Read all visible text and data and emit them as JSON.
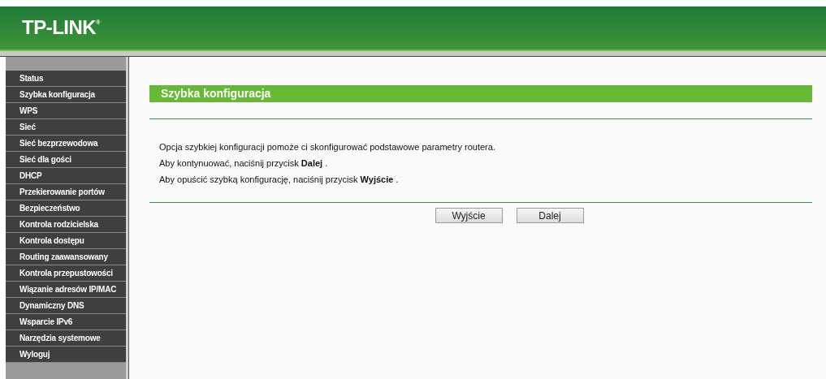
{
  "header": {
    "logo": "TP-LINK",
    "logo_mark": "®"
  },
  "sidebar": {
    "items": [
      {
        "label": "Status"
      },
      {
        "label": "Szybka konfiguracja"
      },
      {
        "label": "WPS"
      },
      {
        "label": "Sieć"
      },
      {
        "label": "Sieć bezprzewodowa"
      },
      {
        "label": "Sieć dla gości"
      },
      {
        "label": "DHCP"
      },
      {
        "label": "Przekierowanie portów"
      },
      {
        "label": "Bezpieczeństwo"
      },
      {
        "label": "Kontrola rodzicielska"
      },
      {
        "label": "Kontrola dostępu"
      },
      {
        "label": "Routing zaawansowany"
      },
      {
        "label": "Kontrola przepustowości"
      },
      {
        "label": "Wiązanie adresów IP/MAC"
      },
      {
        "label": "Dynamiczny DNS"
      },
      {
        "label": "Wsparcie IPv6"
      },
      {
        "label": "Narzędzia systemowe"
      },
      {
        "label": "Wyloguj"
      }
    ]
  },
  "panel": {
    "title": "Szybka konfiguracja",
    "paragraphs": [
      "Opcja szybkiej konfiguracji pomoże ci skonfigurować podstawowe parametry routera.",
      "Aby kontynuować, naciśnij przycisk **Dalej** .",
      "Aby opuścić szybką konfigurację, naciśnij przycisk **Wyjście** ."
    ],
    "buttons": [
      "Wyjście",
      "Dalej"
    ]
  }
}
